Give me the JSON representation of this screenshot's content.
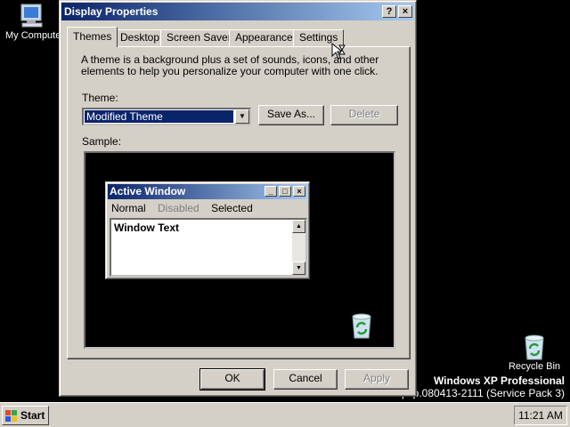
{
  "desktop": {
    "my_computer_label": "My Computer",
    "recycle_bin_label": "Recycle Bin",
    "watermark_line1": "Windows XP Professional",
    "watermark_line2": "psp.080413-2111 (Service Pack 3)"
  },
  "dialog": {
    "title": "Display Properties",
    "help_button": "?",
    "close_button": "×",
    "tabs": [
      {
        "label": "Themes",
        "active": true
      },
      {
        "label": "Desktop",
        "active": false
      },
      {
        "label": "Screen Saver",
        "active": false
      },
      {
        "label": "Appearance",
        "active": false
      },
      {
        "label": "Settings",
        "active": false
      }
    ],
    "description": "A theme is a background plus a set of sounds, icons, and other elements to help you personalize your computer with one click.",
    "theme_label": "Theme:",
    "theme_value": "Modified Theme",
    "save_as_button": "Save As...",
    "delete_button": "Delete",
    "sample_label": "Sample:",
    "sample": {
      "window_title": "Active Window",
      "menu": [
        "Normal",
        "Disabled",
        "Selected"
      ],
      "window_text": "Window Text"
    },
    "ok_button": "OK",
    "cancel_button": "Cancel",
    "apply_button": "Apply"
  },
  "taskbar": {
    "start_label": "Start",
    "clock": "11:21 AM"
  },
  "colors": {
    "title_active": "#0a246a",
    "title_gradient_end": "#a6caf0",
    "face": "#d4d0c8",
    "selection": "#0a246a"
  }
}
